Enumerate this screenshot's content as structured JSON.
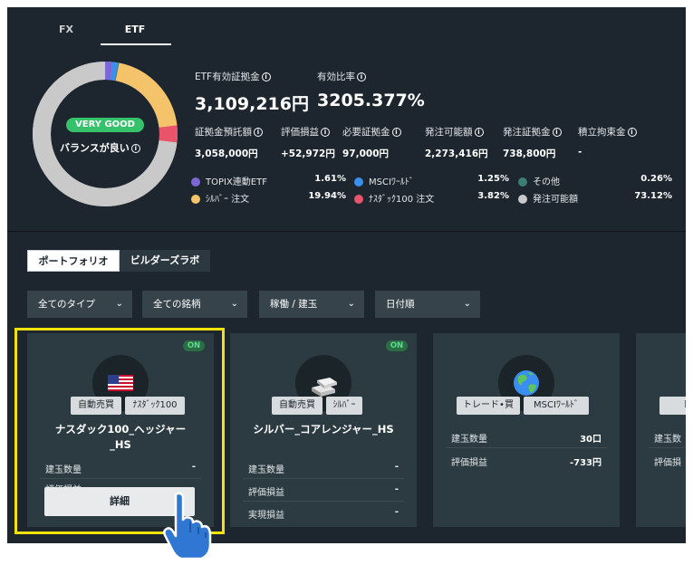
{
  "tabs": {
    "fx": "FX",
    "etf": "ETF"
  },
  "donut": {
    "badge": "VERY GOOD",
    "label": "バランスが良い",
    "segments": [
      {
        "color": "#7b68d6",
        "pct": 1.61
      },
      {
        "color": "#3a8ef0",
        "pct": 1.25
      },
      {
        "color": "#3b7c74",
        "pct": 0.26
      },
      {
        "color": "#f4c36a",
        "pct": 19.94
      },
      {
        "color": "#e9546b",
        "pct": 3.82
      },
      {
        "color": "#c9c9c9",
        "pct": 73.12
      }
    ]
  },
  "summary": {
    "etf_margin_label": "ETF有効証拠金",
    "etf_margin_value": "3,109,216円",
    "ratio_label": "有効比率",
    "ratio_value": "3205.377%"
  },
  "metrics": [
    {
      "label": "証拠金預託額",
      "value": "3,058,000円"
    },
    {
      "label": "評価損益",
      "value": "+52,972円"
    },
    {
      "label": "必要証拠金",
      "value": "97,000円"
    },
    {
      "label": "発注可能額",
      "value": "2,273,416円"
    },
    {
      "label": "発注証拠金",
      "value": "738,800円"
    },
    {
      "label": "積立拘束金",
      "value": "-"
    }
  ],
  "legend": [
    {
      "name": "TOPIX連動ETF",
      "pct": "1.61%",
      "color": "#7b68d6"
    },
    {
      "name": "MSCIﾜｰﾙﾄﾞ",
      "pct": "1.25%",
      "color": "#3a8ef0"
    },
    {
      "name": "その他",
      "pct": "0.26%",
      "color": "#3b7c74"
    },
    {
      "name": "ｼﾙﾊﾞｰ 注文",
      "pct": "19.94%",
      "color": "#f4c36a"
    },
    {
      "name": "ﾅｽﾀﾞｯｸ100 注文",
      "pct": "3.82%",
      "color": "#e9546b"
    },
    {
      "name": "発注可能額",
      "pct": "73.12%",
      "color": "#c9c9c9"
    }
  ],
  "subtabs": {
    "portfolio": "ポートフォリオ",
    "builder": "ビルダーズラボ"
  },
  "filters": {
    "type": "全てのタイプ",
    "symbol": "全ての銘柄",
    "status": "稼働 / 建玉",
    "sort": "日付順"
  },
  "cards": [
    {
      "on": "ON",
      "tag1": "自動売買",
      "tag2": "ﾅｽﾀﾞｯｸ100",
      "title_line1": "ナスダック100_ヘッジャー",
      "title_line2": "_HS",
      "rows": [
        {
          "label": "建玉数量",
          "value": "-"
        },
        {
          "label": "評価損益",
          "value": ""
        }
      ],
      "button": "詳細"
    },
    {
      "on": "ON",
      "tag1": "自動売買",
      "tag2": "ｼﾙﾊﾞｰ",
      "title_line1": "シルバー_コアレンジャー_HS",
      "rows": [
        {
          "label": "建玉数量",
          "value": "-"
        },
        {
          "label": "評価損益",
          "value": "-"
        },
        {
          "label": "実現損益",
          "value": "-"
        }
      ]
    },
    {
      "tag1": "トレード•買",
      "tag2": "MSCIﾜｰﾙﾄﾞ",
      "rows": [
        {
          "label": "建玉数量",
          "value": "30口"
        },
        {
          "label": "評価損益",
          "value": "-733円"
        }
      ]
    },
    {
      "tag1": "トレ",
      "rows": [
        {
          "label": "建玉数",
          "value": ""
        },
        {
          "label": "評価損",
          "value": ""
        }
      ]
    }
  ]
}
